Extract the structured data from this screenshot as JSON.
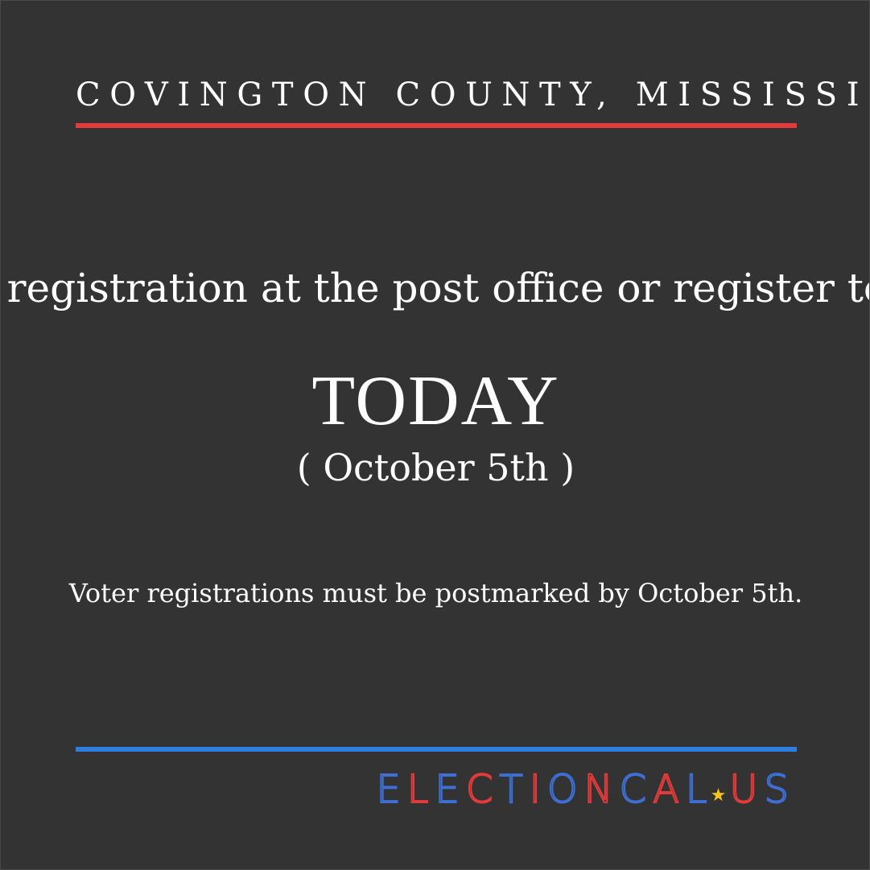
{
  "header": {
    "title": "COVINGTON COUNTY, MISSISSIPPI"
  },
  "message": {
    "headline": "Mail your voter registration at the post office or register to vote in person",
    "emphasis": "TODAY",
    "date": "( October 5th )",
    "note": "Voter registrations must be postmarked by October 5th."
  },
  "logo": {
    "text": "ELECTIONCAL.US"
  },
  "colors": {
    "background": "#333333",
    "accent_red": "#e53a3a",
    "accent_blue": "#2f7de1",
    "star": "#f5c518"
  }
}
